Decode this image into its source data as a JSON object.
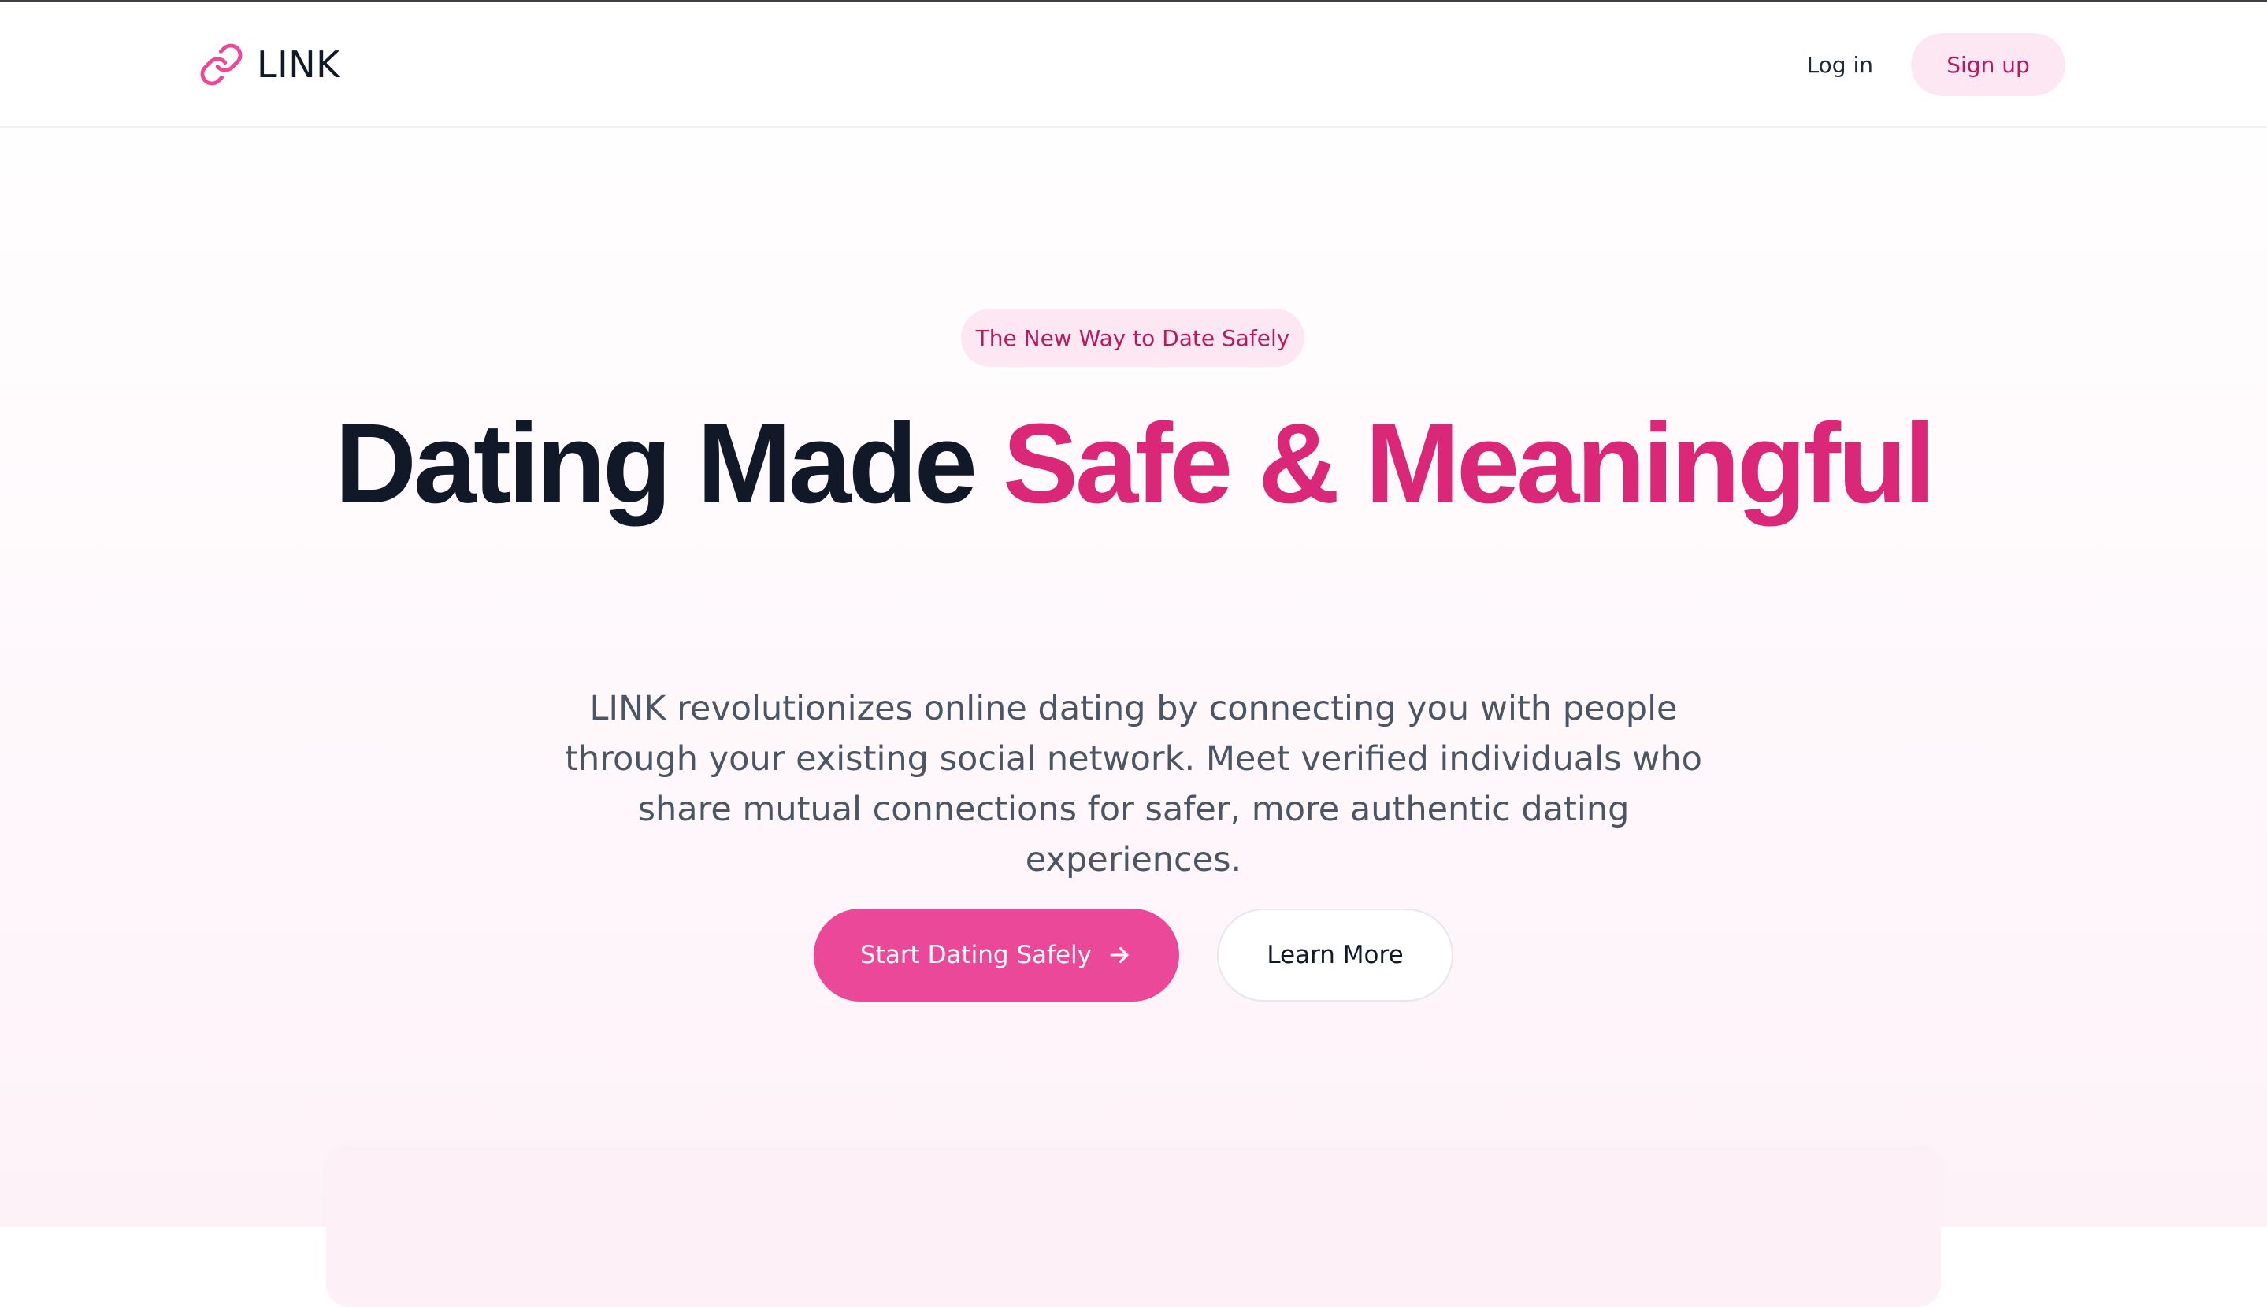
{
  "header": {
    "brand_name": "LINK",
    "brand_icon": "link-chain-icon",
    "login_label": "Log in",
    "signup_label": "Sign up"
  },
  "hero": {
    "badge": "The New Way to Date Safely",
    "title_part1": "Dating Made ",
    "title_accent": "Safe & Meaningful",
    "subtitle": "LINK revolutionizes online dating by connecting you with people through your existing social network. Meet verified individuals who share mutual connections for safer, more authentic dating experiences.",
    "primary_cta": "Start Dating Safely",
    "primary_cta_icon": "arrow-right-icon",
    "secondary_cta": "Learn More"
  },
  "colors": {
    "accent": "#db2777",
    "primary_button": "#ec4899",
    "badge_bg": "#fce7f3",
    "heading": "#111827",
    "body_text": "#4b5563"
  }
}
